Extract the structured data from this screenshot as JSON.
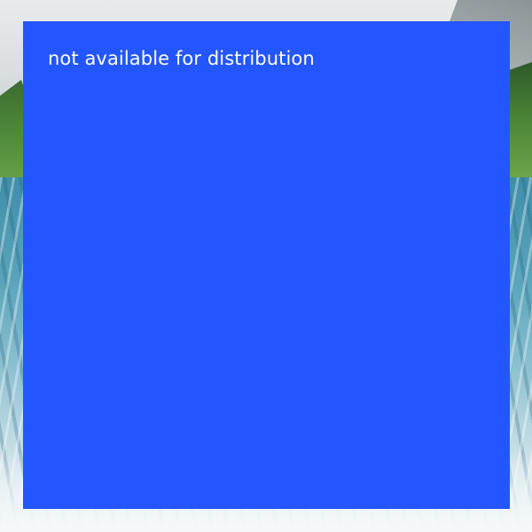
{
  "notice": {
    "text": "not available for distribution"
  },
  "colors": {
    "overlay": "#2356fe",
    "text": "#ffffff"
  }
}
